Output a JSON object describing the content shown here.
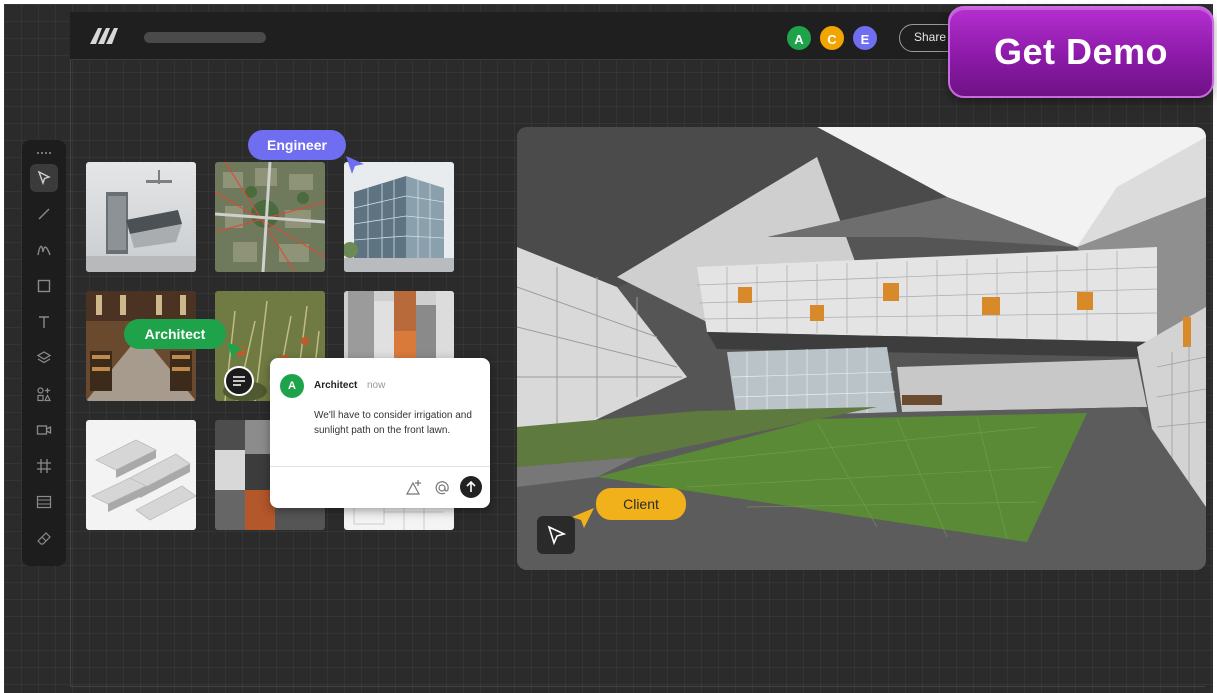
{
  "header": {
    "share_label": "Share",
    "avatars": [
      {
        "initial": "A",
        "color": "#1fa34a"
      },
      {
        "initial": "C",
        "color": "#f0a500"
      },
      {
        "initial": "E",
        "color": "#6f6ef0"
      }
    ]
  },
  "cta": {
    "label": "Get Demo",
    "color": "#9b24b8"
  },
  "toolbar": {
    "icons": [
      "drag-handle-icon",
      "pointer-icon",
      "line-icon",
      "pen-icon",
      "rectangle-icon",
      "text-icon",
      "layers-icon",
      "shapes-icon",
      "camera-icon",
      "grid-icon",
      "frame-icon",
      "eraser-icon"
    ]
  },
  "tags": {
    "engineer": {
      "label": "Engineer",
      "color": "#6f6ef0"
    },
    "architect": {
      "label": "Architect",
      "color": "#1fa34a"
    },
    "client": {
      "label": "Client",
      "color": "#f0b11a"
    }
  },
  "comment": {
    "initial": "A",
    "author": "Architect",
    "time": "now",
    "text": "We'll have to consider irrigation and sunlight path on the front lawn."
  }
}
